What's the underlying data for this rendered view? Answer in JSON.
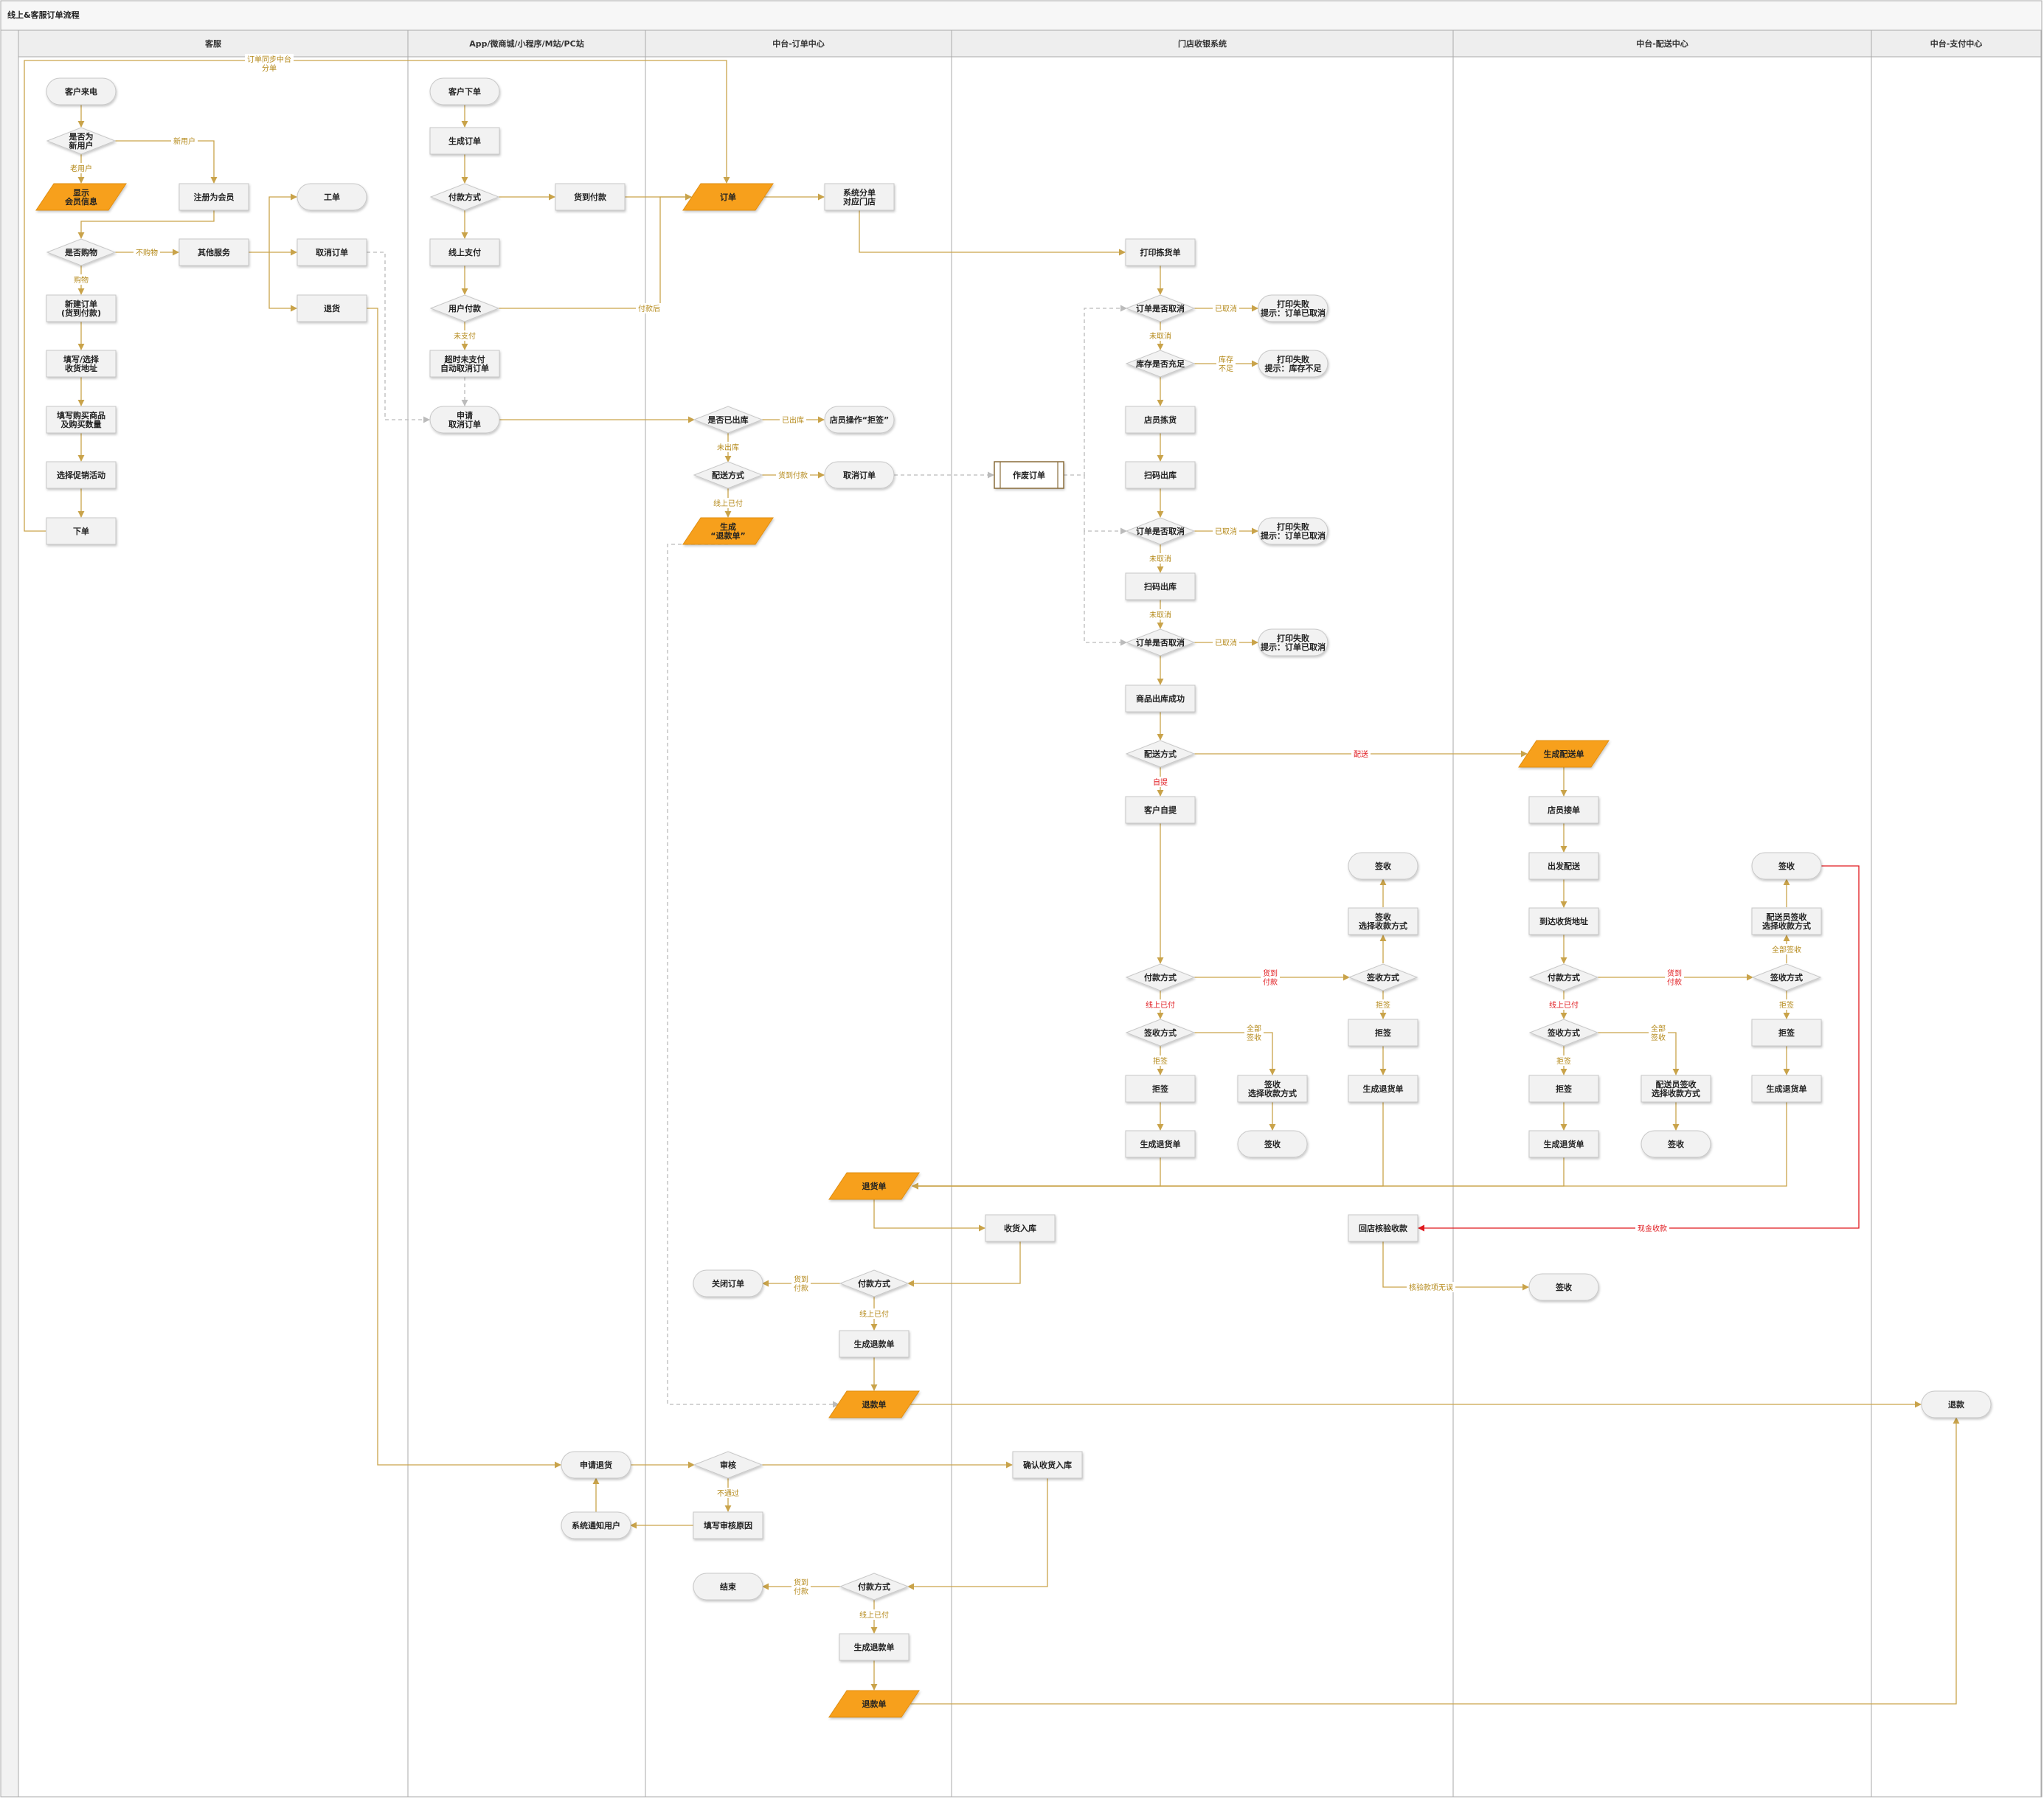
{
  "title": "线上&客服订单流程",
  "lanes": [
    "客服",
    "App/微商城/小程序/M站/PC站",
    "中台-订单中心",
    "门店收银系统",
    "中台-配送中心",
    "中台-支付中心"
  ],
  "nodes": {
    "kf_call": "客户来电",
    "kf_isnew": "是否为\n新用户",
    "kf_showinfo": "显示\n会员信息",
    "kf_register": "注册为会员",
    "kf_isbuy": "是否购物",
    "kf_other": "其他服务",
    "kf_workorder": "工单",
    "kf_cancel": "取消订单",
    "kf_return": "退货",
    "kf_neworder": "新建订单\n(货到付款)",
    "kf_address": "填写/选择\n收货地址",
    "kf_goods": "填写购买商品\n及购买数量",
    "kf_promo": "选择促销活动",
    "kf_place": "下单",
    "app_order": "客户下单",
    "app_gen": "生成订单",
    "app_paymode": "付款方式",
    "app_cod": "货到付款",
    "app_online": "线上支付",
    "app_userpay": "用户付款",
    "app_timeout": "超时未支付\n自动取消订单",
    "app_applycancel": "申请\n取消订单",
    "app_applyreturn": "申请退货",
    "app_notify": "系统通知用户",
    "oc_order": "订单",
    "oc_split": "系统分单\n对应门店",
    "oc_shipped": "是否已出库",
    "oc_reject": "店员操作“拒签”",
    "oc_deliver": "配送方式",
    "oc_cancel": "取消订单",
    "oc_refundgen": "生成\n“退款单”",
    "oc_returnslip": "退货单",
    "oc_paymode2": "付款方式",
    "oc_close": "关闭订单",
    "oc_genrefund": "生成退款单",
    "oc_refund": "退款单",
    "oc_audit": "审核",
    "oc_auditfill": "填写审核原因",
    "oc_paymode3": "付款方式",
    "oc_end": "结束",
    "oc_genrefund2": "生成退款单",
    "oc_refund2": "退款单",
    "st_print": "打印拣货单",
    "st_cancelq1": "订单是否取消",
    "st_fail1": "打印失败\n提示：订单已取消",
    "st_stockq": "库存是否充足",
    "st_fail2": "打印失败\n提示：库存不足",
    "st_pick": "店员拣货",
    "st_scan1": "扫码出库",
    "st_void": "作废订单",
    "st_cancelq2": "订单是否取消",
    "st_fail3": "打印失败\n提示：订单已取消",
    "st_scan2": "扫码出库",
    "st_cancelq3": "订单是否取消",
    "st_fail4": "打印失败\n提示：订单已取消",
    "st_outok": "商品出库成功",
    "st_delivery": "配送方式",
    "st_selfpick": "客户自提",
    "st_pay": "付款方式",
    "st_signmode": "签收方式",
    "st_reject": "拒签",
    "st_genreturn": "生成退货单",
    "st_signsel": "签收\n选择收款方式",
    "st_sign1": "签收",
    "st_signmode2": "签收方式",
    "st_reject2": "拒签",
    "st_genreturn2": "生成退货单",
    "st_signsel2": "签收\n选择收款方式",
    "st_sign2": "签收",
    "st_receive": "收货入库",
    "st_verify": "回店核验收款",
    "st_confirm": "确认收货入库",
    "dc_gen": "生成配送单",
    "dc_accept": "店员接单",
    "dc_depart": "出发配送",
    "dc_arrive": "到达收货地址",
    "dc_pay": "付款方式",
    "dc_signmode": "签收方式",
    "dc_reject": "拒签",
    "dc_genreturn": "生成退货单",
    "dc_signsel": "配送员签收\n选择收款方式",
    "dc_sign1": "签收",
    "dc_signmode2": "签收方式",
    "dc_reject2": "拒签",
    "dc_genreturn2": "生成退货单",
    "dc_signsel2": "配送员签收\n选择收款方式",
    "dc_sign2": "签收",
    "dc_sign3": "签收",
    "pc_refund": "退款"
  },
  "edge_labels": {
    "split": "订单同步中台\n分单",
    "newuser": "新用户",
    "olduser": "老用户",
    "nobuy": "不购物",
    "buy": "购物",
    "afterpay": "付款后",
    "unpaid": "未支付",
    "shipped": "已出库",
    "notshipped": "未出库",
    "cod": "货到付款",
    "onlinepaid": "线上已付",
    "cancelled1": "已取消",
    "notcancelled1": "未取消",
    "stockout": "库存\n不足",
    "cancelled2": "已取消",
    "notcancelled2": "未取消",
    "notcancelled3": "未取消",
    "cancelled3": "已取消",
    "deliver": "配送",
    "selfpick": "自提",
    "cod_st": "货到\n付款",
    "online_st": "线上已付",
    "all_st": "全部\n签收",
    "reject_st": "拒签",
    "reject_st2": "拒签",
    "all_st2": "全部签收",
    "cod_dc": "货到\n付款",
    "online_dc": "线上已付",
    "all_dc": "全部\n签收",
    "reject_dc": "拒签",
    "reject_dc2": "拒签",
    "all_dc2": "全部签收",
    "cashin": "现金收款",
    "verifyok": "核验款项无误",
    "cod2": "货到\n付款",
    "online2": "线上已付",
    "notpass": "不通过",
    "cod3": "货到\n付款",
    "online3": "线上已付"
  },
  "colors": {
    "accent": "#f7a01e",
    "line": "#c9a34a",
    "red": "#e0191e",
    "lane_header": "#eeeeee",
    "lane_border": "#aaaaaa",
    "node_fill": "#f2f2f2",
    "node_stroke": "#c8c8c8"
  }
}
